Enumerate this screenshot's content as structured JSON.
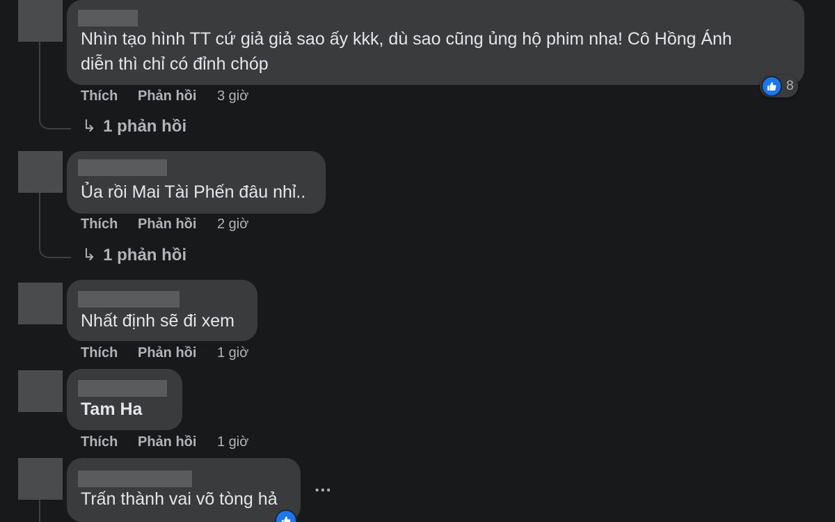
{
  "comments": [
    {
      "lines": [
        "Nhìn tạo hình TT cứ giả giả sao ấy kkk, dù sao cũng ủng hộ phim nha! Cô Hồng Ánh",
        "diễn thì chỉ có đỉnh chóp"
      ],
      "like_label": "Thích",
      "reply_label": "Phản hồi",
      "time": "3 giờ",
      "reaction_count": "8",
      "replies_label": "1 phản hồi"
    },
    {
      "lines": [
        "Ủa rồi Mai Tài Phến đâu nhỉ.."
      ],
      "like_label": "Thích",
      "reply_label": "Phản hồi",
      "time": "2 giờ",
      "replies_label": "1 phản hồi"
    },
    {
      "lines": [
        "Nhất định sẽ đi xem"
      ],
      "like_label": "Thích",
      "reply_label": "Phản hồi",
      "time": "1 giờ"
    },
    {
      "lines": [
        "Tam Ha"
      ],
      "like_label": "Thích",
      "reply_label": "Phản hồi",
      "time": "1 giờ"
    },
    {
      "lines": [
        "Trấn thành vai võ tòng hả"
      ],
      "more_label": "..."
    }
  ],
  "icons": {
    "reply_arrow": "↳",
    "like": "thumbs-up-icon"
  },
  "colors": {
    "background": "#18191a",
    "bubble": "#3a3b3c",
    "text": "#e4e6eb",
    "secondary_text": "#b0b3b8",
    "like_blue": "#1877f2"
  }
}
